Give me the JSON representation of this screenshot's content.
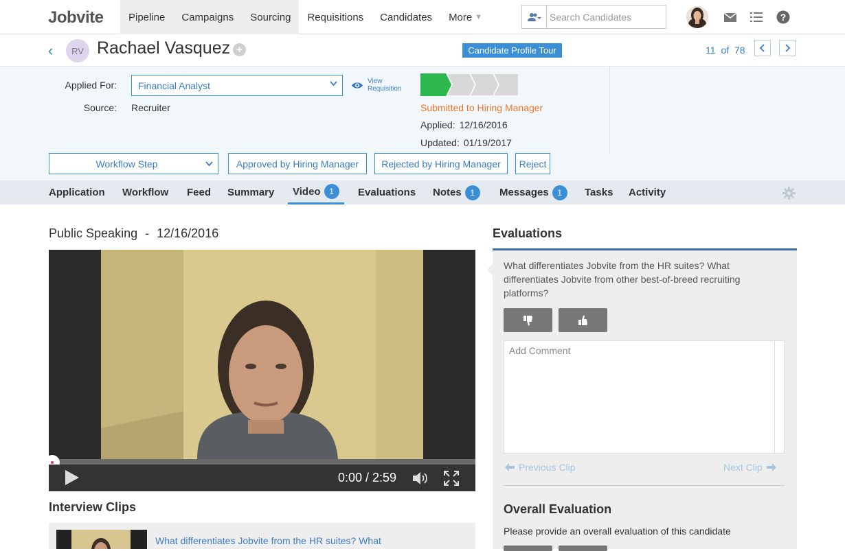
{
  "brand": {
    "logo": "Jobvite",
    "accent": "#3b8fd6",
    "status_color": "#e8782b"
  },
  "topnav": {
    "items": [
      "Pipeline",
      "Campaigns",
      "Sourcing",
      "Requisitions",
      "Candidates",
      "More"
    ],
    "search_placeholder": "Search Candidates",
    "icons": [
      "people-icon",
      "mail-icon",
      "list-icon",
      "help-icon"
    ]
  },
  "candidate": {
    "initials": "RV",
    "name": "Rachael Vasquez",
    "tour_label": "Candidate Profile Tour",
    "position": "11",
    "of_label": "of",
    "total": "78"
  },
  "info": {
    "applied_for_label": "Applied For:",
    "applied_for_value": "Financial Analyst",
    "source_label": "Source:",
    "source_value": "Recruiter",
    "view_req_line1": "View",
    "view_req_line2": "Requisition",
    "progress_steps_total": 4,
    "progress_steps_done": 1,
    "status": "Submitted to Hiring Manager",
    "applied_label": "Applied:",
    "applied_date": "12/16/2016",
    "updated_label": "Updated:",
    "updated_date": "01/19/2017"
  },
  "actions": {
    "workflow_step": "Workflow Step",
    "approve": "Approved by Hiring Manager",
    "reject_hm": "Rejected by Hiring Manager",
    "reject": "Reject"
  },
  "tabs": [
    {
      "label": "Application"
    },
    {
      "label": "Workflow"
    },
    {
      "label": "Feed"
    },
    {
      "label": "Summary"
    },
    {
      "label": "Video",
      "badge": "1"
    },
    {
      "label": "Evaluations"
    },
    {
      "label": "Notes",
      "badge": "1"
    },
    {
      "label": "Messages",
      "badge": "1"
    },
    {
      "label": "Tasks"
    },
    {
      "label": "Activity"
    }
  ],
  "video": {
    "clip_name": "Public Speaking",
    "separator": "-",
    "clip_date": "12/16/2016",
    "time": "0:00 / 2:59",
    "progress_fraction": 0
  },
  "clips": {
    "header": "Interview Clips",
    "first_clip_text": "What differentiates Jobvite from the HR suites? What"
  },
  "evaluations": {
    "header": "Evaluations",
    "question": "What differentiates Jobvite from the HR suites? What differentiates Jobvite from other best-of-breed recruiting platforms?",
    "comment_placeholder": "Add Comment",
    "prev_clip": "Previous Clip",
    "next_clip": "Next Clip",
    "overall_title": "Overall Evaluation",
    "overall_sub": "Please provide an overall evaluation of this candidate"
  }
}
